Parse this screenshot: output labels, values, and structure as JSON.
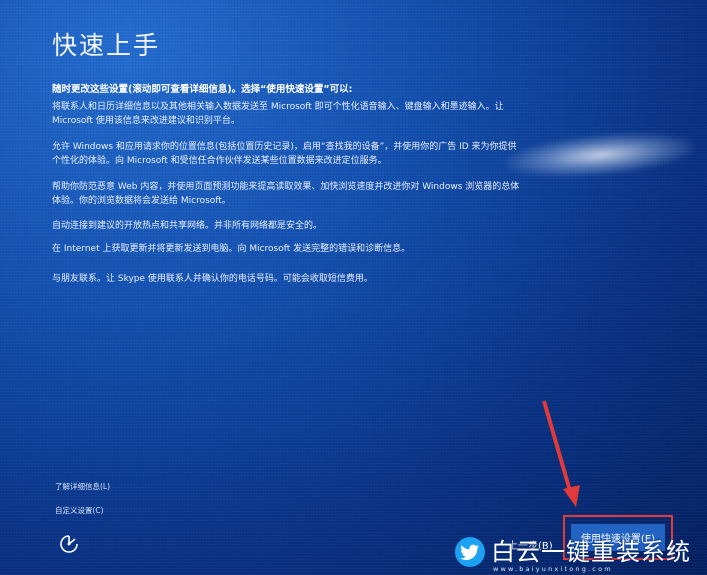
{
  "screen": {
    "title": "快速上手",
    "lead": "随时更改这些设置(滚动即可查看详细信息)。选择“使用快速设置”可以:",
    "paragraphs": [
      "将联系人和日历详细信息以及其他相关输入数据发送至 Microsoft 即可个性化语音输入、键盘输入和墨迹输入。让 Microsoft 使用该信息来改进建议和识别平台。",
      "允许 Windows 和应用请求你的位置信息(包括位置历史记录)，启用“查找我的设备”，并使用你的广告 ID 来为你提供个性化的体验。向 Microsoft 和受信任合作伙伴发送某些位置数据来改进定位服务。",
      "帮助你防范恶意 Web 内容，并使用页面预测功能来提高读取效果、加快浏览速度并改进你对 Windows 浏览器的总体体验。你的浏览数据将会发送给 Microsoft。",
      "自动连接到建议的开放热点和共享网络。并非所有网络都是安全的。",
      "在 Internet 上获取更新并将更新发送到电脑。向 Microsoft 发送完整的错误和诊断信息。",
      "与朋友联系。让 Skype 使用联系人并确认你的电话号码。可能会收取短信费用。"
    ],
    "links": {
      "learn_more": "了解详细信息(L)",
      "customize": "自定义设置(C)"
    },
    "buttons": {
      "back": "上一步(B)",
      "express": "使用快速设置(E)"
    },
    "icons": {
      "accessibility": "ease-of-access-icon",
      "annotation_arrow": "red-arrow-icon",
      "watermark_logo": "bird-logo-icon"
    },
    "watermark": {
      "brand": "白云一键重装系统",
      "url": "www.baiyunxitong.com"
    },
    "colors": {
      "background": "#0a3f8f",
      "highlight_box": "#e23a3a",
      "arrow": "#e23a3a",
      "watermark_logo": "#1da1f2"
    }
  }
}
